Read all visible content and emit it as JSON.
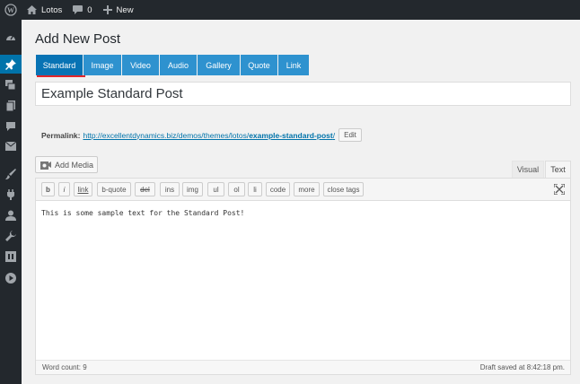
{
  "adminbar": {
    "site_name": "Lotos",
    "comment_count": "0",
    "new_label": "New"
  },
  "page": {
    "title": "Add New Post"
  },
  "format_tabs": [
    {
      "label": "Standard",
      "active": true
    },
    {
      "label": "Image"
    },
    {
      "label": "Video"
    },
    {
      "label": "Audio"
    },
    {
      "label": "Gallery"
    },
    {
      "label": "Quote"
    },
    {
      "label": "Link"
    }
  ],
  "post": {
    "title": "Example Standard Post",
    "permalink_label": "Permalink:",
    "permalink_base": "http://excellentdynamics.biz/demos/themes/lotos/",
    "permalink_slug": "example-standard-post",
    "permalink_tail": "/",
    "edit_label": "Edit"
  },
  "editor": {
    "add_media_label": "Add Media",
    "visual_tab": "Visual",
    "text_tab": "Text",
    "toolbar": [
      "b",
      "i",
      "link",
      "b-quote",
      "del",
      "ins",
      "img",
      "ul",
      "ol",
      "li",
      "code",
      "more",
      "close tags"
    ],
    "content": "This is some sample text for the Standard Post!",
    "word_count": "Word count: 9",
    "draft_status": "Draft saved at 8:42:18 pm."
  },
  "colors": {
    "adminbar_bg": "#23282d",
    "tab_blue": "#2e92cf",
    "tab_active": "#0873b4",
    "underline_red": "#e2262a",
    "link_blue": "#0073aa"
  }
}
